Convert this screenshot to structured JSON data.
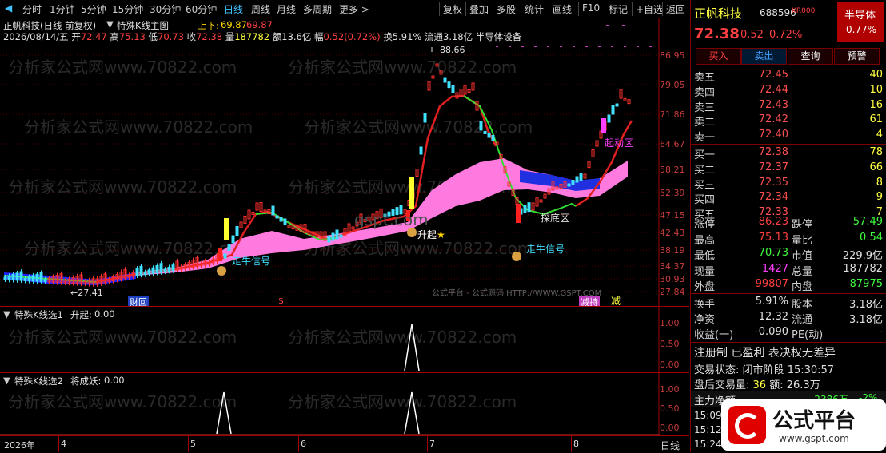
{
  "toolbar": {
    "left": [
      "分时",
      "1分钟",
      "5分钟",
      "15分钟",
      "30分钟",
      "60分钟",
      "日线",
      "周线",
      "月线",
      "多周期",
      "更多 >"
    ],
    "right": [
      "复权",
      "叠加",
      "多股",
      "统计",
      "画线",
      "F10",
      "标记",
      "+自选",
      "返回"
    ]
  },
  "main": {
    "title": "正帆科技(日线 前复权)",
    "indicator": "特殊K线主图",
    "updown_label": "上下:",
    "updown_v1": "69.87",
    "updown_v2": "69.87",
    "ohlc": {
      "date": "2026/08/14/五",
      "open_label": "开",
      "open": "72.47",
      "high_label": "高",
      "high": "75.13",
      "low_label": "低",
      "low": "70.73",
      "close_label": "收",
      "close": "72.38",
      "vol_label": "量",
      "vol": "187782",
      "amt_label": "额",
      "amt": "13.6亿",
      "chg_label": "幅",
      "chg": "0.52(0.72%)",
      "turn_label": "换",
      "turn": "5.91%",
      "float_label": "流通",
      "float": "3.18亿",
      "sector": "半导体设备"
    },
    "axis": [
      "86.95",
      "79.05",
      "71.86",
      "64.67",
      "58.21",
      "52.39",
      "47.15",
      "42.43",
      "38.19",
      "34.37",
      "30.93",
      "27.84"
    ],
    "annotations": {
      "peak": "88.66",
      "trough": "27.41",
      "rise": "升起",
      "rise_star": "★",
      "bull1": "走牛信号",
      "bull2": "走牛信号",
      "bottom": "探底区",
      "start": "起动区",
      "finance": "财",
      "fin2": "回",
      "s_mark": "$",
      "rebate": "减持",
      "reduce": "减"
    },
    "footer_watermark": "公式平台 - 公式源码 HTTP://WWW.GSPT.COM",
    "site_wm": "gspt.com"
  },
  "sub1": {
    "name": "特殊K线选1",
    "field": "升起:",
    "value": "0.00",
    "axis": [
      "1.00",
      "0.50",
      "0.00"
    ]
  },
  "sub2": {
    "name": "特殊K线选2",
    "field": "将成妖:",
    "value": "0.00",
    "axis": [
      "1.00",
      "0.50",
      "0.00"
    ]
  },
  "timeaxis": {
    "labels": [
      "2026年",
      "4",
      "5",
      "6",
      "7",
      "8"
    ],
    "period": "日线"
  },
  "watermark": "分析家公式网www.70822.com",
  "panel": {
    "name": "正帆科技",
    "code": "688596",
    "tag": "KR000",
    "sector": "半导体",
    "sector_chg": "0.77%",
    "price": "72.38",
    "chg": "0.52",
    "pct": "0.72%",
    "buttons": [
      "买入",
      "卖出",
      "查询",
      "预警"
    ],
    "asks": [
      {
        "label": "卖五",
        "price": "72.45",
        "vol": "40"
      },
      {
        "label": "卖四",
        "price": "72.44",
        "vol": "10"
      },
      {
        "label": "卖三",
        "price": "72.43",
        "vol": "16"
      },
      {
        "label": "卖二",
        "price": "72.42",
        "vol": "61"
      },
      {
        "label": "卖一",
        "price": "72.40",
        "vol": "4"
      }
    ],
    "bids": [
      {
        "label": "买一",
        "price": "72.38",
        "vol": "78"
      },
      {
        "label": "买二",
        "price": "72.37",
        "vol": "66"
      },
      {
        "label": "买三",
        "price": "72.35",
        "vol": "8"
      },
      {
        "label": "买四",
        "price": "72.34",
        "vol": "9"
      },
      {
        "label": "买五",
        "price": "72.33",
        "vol": "7"
      }
    ],
    "stats": [
      {
        "l1": "涨停",
        "v1": "86.23",
        "l2": "跌停",
        "v2": "57.49"
      },
      {
        "l1": "最高",
        "v1": "75.13",
        "l2": "量比",
        "v2": "0.54"
      },
      {
        "l1": "最低",
        "v1": "70.73",
        "l2": "市值",
        "v2": "229.9亿"
      },
      {
        "l1": "现量",
        "v1": "1427",
        "l2": "总量",
        "v2": "187782"
      },
      {
        "l1": "外盘",
        "v1": "99807",
        "l2": "内盘",
        "v2": "87975"
      }
    ],
    "stats2": [
      {
        "l1": "换手",
        "v1": "5.91%",
        "l2": "股本",
        "v2": "3.18亿"
      },
      {
        "l1": "净资",
        "v1": "12.32",
        "l2": "流通",
        "v2": "3.18亿"
      },
      {
        "l1": "收益(一)",
        "v1": "-0.090",
        "l2": "PE(动)",
        "v2": "-"
      }
    ],
    "reg": "注册制 已盈利 表决权无差异",
    "state_label": "交易状态:",
    "state": "闭市阶段",
    "state_time": "15:30:57",
    "after_label": "盘后交易量:",
    "after_vol": "36",
    "after_amt_label": "额:",
    "after_amt": "26.3万",
    "main_net_label": "主力净额",
    "main_net": "-2386万",
    "main_net_pct": "-2%",
    "ticks": [
      "15:09",
      "15:12",
      "15:24"
    ],
    "logo_text": "公式平台",
    "logo_url": "www.gspt.com"
  }
}
